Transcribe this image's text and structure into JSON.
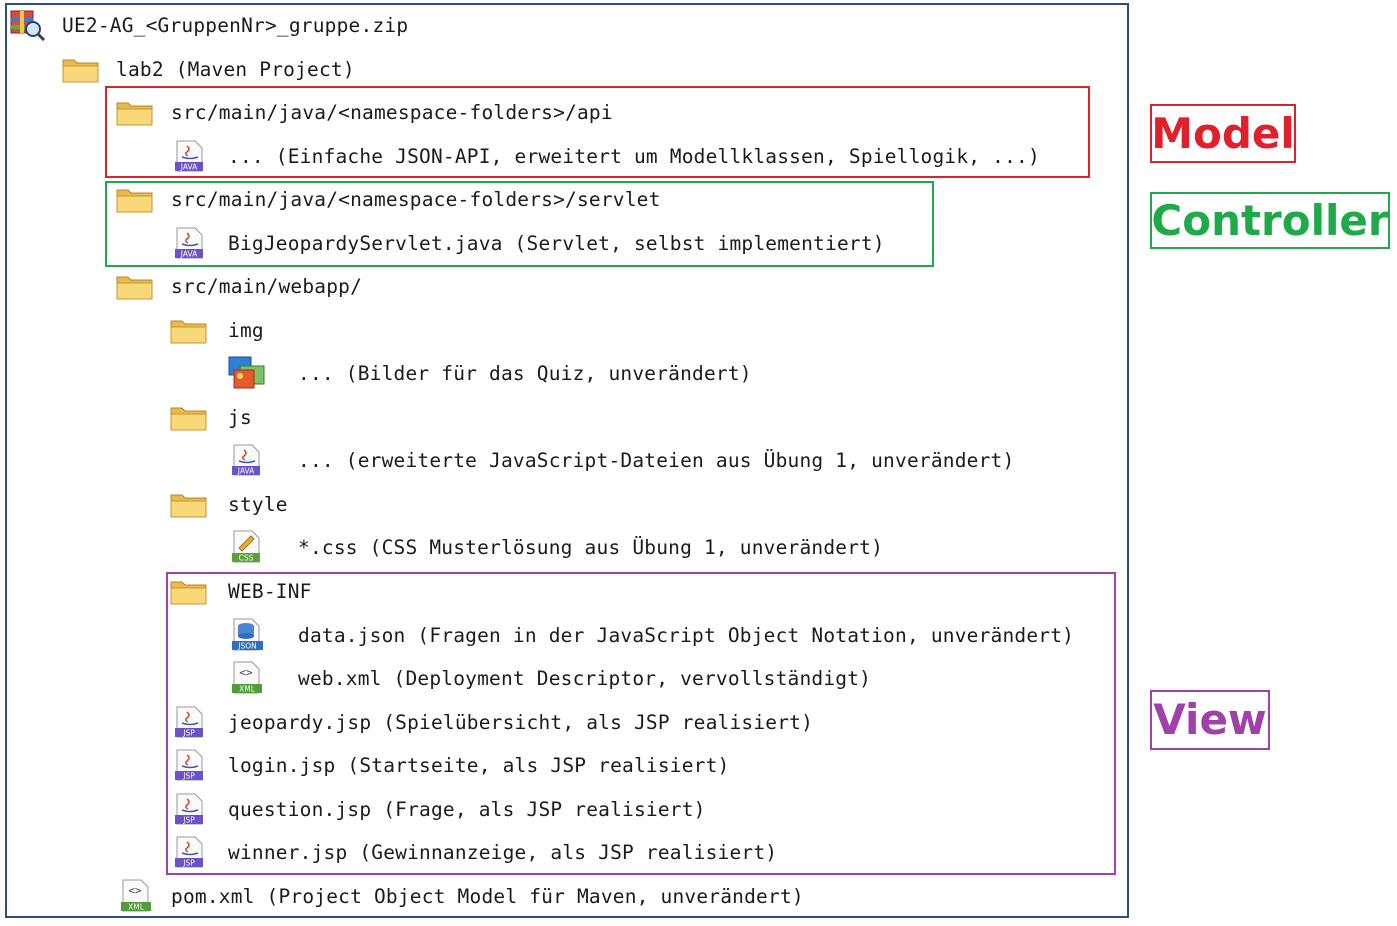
{
  "colors": {
    "frame": "#2e4d7f",
    "model": "#e0202a",
    "controller": "#1faa4a",
    "view": "#a040a8",
    "folder": "#f3c75b",
    "java_badge": "#6a52c9",
    "css_badge": "#5aa33a",
    "xml_badge": "#4f9e3a",
    "json_badge": "#2f6fbf"
  },
  "tree": [
    {
      "icon": "archive-icon",
      "label": "UE2-AG_<GruppenNr>_gruppe.zip"
    },
    {
      "icon": "folder-icon",
      "label": "lab2 (Maven Project)"
    },
    {
      "icon": "folder-icon",
      "label": "src/main/java/<namespace-folders>/api"
    },
    {
      "icon": "java-file-icon",
      "label": "... (Einfache JSON-API, erweitert um Modellklassen, Spiellogik, ...)"
    },
    {
      "icon": "folder-icon",
      "label": "src/main/java/<namespace-folders>/servlet"
    },
    {
      "icon": "java-file-icon",
      "label": "BigJeopardyServlet.java (Servlet, selbst implementiert)"
    },
    {
      "icon": "folder-icon",
      "label": "src/main/webapp/"
    },
    {
      "icon": "folder-icon",
      "label": "img"
    },
    {
      "icon": "image-file-icon",
      "label": "... (Bilder für das Quiz, unverändert)"
    },
    {
      "icon": "folder-icon",
      "label": "js"
    },
    {
      "icon": "java-file-icon",
      "label": "... (erweiterte JavaScript-Dateien aus Übung 1, unverändert)"
    },
    {
      "icon": "folder-icon",
      "label": "style"
    },
    {
      "icon": "css-file-icon",
      "label": "*.css (CSS Musterlösung aus Übung 1, unverändert)"
    },
    {
      "icon": "folder-icon",
      "label": "WEB-INF"
    },
    {
      "icon": "json-file-icon",
      "label": "data.json (Fragen in der JavaScript Object Notation, unverändert)"
    },
    {
      "icon": "xml-file-icon",
      "label": "web.xml (Deployment Descriptor, vervollständigt)"
    },
    {
      "icon": "jsp-file-icon",
      "label": "jeopardy.jsp (Spielübersicht, als JSP realisiert)"
    },
    {
      "icon": "jsp-file-icon",
      "label": "login.jsp (Startseite, als JSP realisiert)"
    },
    {
      "icon": "jsp-file-icon",
      "label": "question.jsp (Frage, als JSP realisiert)"
    },
    {
      "icon": "jsp-file-icon",
      "label": "winner.jsp (Gewinnanzeige, als JSP realisiert)"
    },
    {
      "icon": "xml-file-icon",
      "label": "pom.xml (Project Object Model für Maven, unverändert)"
    }
  ],
  "icon_badges": {
    "java": "JAVA",
    "jsp": "JSP",
    "css": "CSS",
    "xml": "XML",
    "json": "JSON",
    "xml_glyph": "<>"
  },
  "groups": {
    "model": "Model",
    "controller": "Controller",
    "view": "View"
  }
}
